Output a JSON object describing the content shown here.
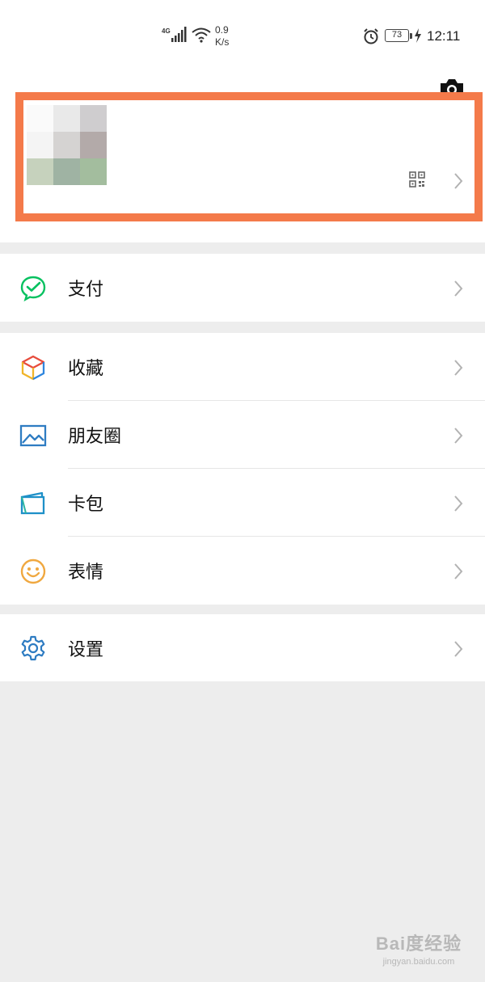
{
  "status_bar": {
    "network": "4G",
    "speed_value": "0.9",
    "speed_unit": "K/s",
    "battery": "73",
    "time": "12:11"
  },
  "profile": {
    "icons": [
      "camera-icon",
      "qr-code-icon",
      "chevron-right-icon"
    ]
  },
  "menu": {
    "pay": {
      "label": "支付",
      "icon": "wechat-pay-icon",
      "color": "#07c160"
    },
    "favorites": {
      "label": "收藏",
      "icon": "favorites-cube-icon"
    },
    "moments": {
      "label": "朋友圈",
      "icon": "moments-photo-icon",
      "color": "#2e7cc2"
    },
    "cards": {
      "label": "卡包",
      "icon": "card-wallet-icon",
      "color": "#1e90c8"
    },
    "stickers": {
      "label": "表情",
      "icon": "sticker-smiley-icon",
      "color": "#f0a840"
    },
    "settings": {
      "label": "设置",
      "icon": "settings-gear-icon",
      "color": "#2e7cc2"
    }
  },
  "watermark": {
    "main": "Bai度经验",
    "sub": "jingyan.baidu.com"
  },
  "colors": {
    "highlight_border": "#f47a4a",
    "background": "#ededed"
  }
}
